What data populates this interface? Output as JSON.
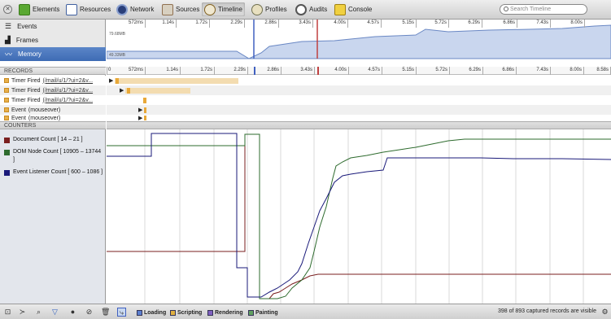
{
  "toolbar": {
    "tabs": [
      {
        "label": "Elements",
        "icon": "elements-icon"
      },
      {
        "label": "Resources",
        "icon": "resources-icon"
      },
      {
        "label": "Network",
        "icon": "network-icon"
      },
      {
        "label": "Sources",
        "icon": "sources-icon"
      },
      {
        "label": "Timeline",
        "icon": "timeline-icon",
        "active": true
      },
      {
        "label": "Profiles",
        "icon": "profiles-icon"
      },
      {
        "label": "Audits",
        "icon": "audits-icon"
      },
      {
        "label": "Console",
        "icon": "console-icon"
      }
    ],
    "search_placeholder": "Search Timeline"
  },
  "overview": {
    "items": [
      {
        "label": "Events",
        "icon": "events-icon"
      },
      {
        "label": "Frames",
        "icon": "frames-icon"
      },
      {
        "label": "Memory",
        "icon": "memory-icon",
        "selected": true
      }
    ],
    "memory_max": "79.68MB",
    "memory_min": "49.33MB"
  },
  "ruler_ticks": [
    "572ms",
    "1.14s",
    "1.72s",
    "2.29s",
    "2.86s",
    "3.43s",
    "4.00s",
    "4.57s",
    "5.15s",
    "5.72s",
    "6.29s",
    "6.86s",
    "7.43s",
    "8.00s",
    "8.58s"
  ],
  "records": {
    "header": "RECORDS",
    "items": [
      {
        "label": "Timer Fired",
        "detail": "(/mail/u/1/?ui=2&v..."
      },
      {
        "label": "Timer Fired",
        "detail": "(/mail/u/1/?ui=2&v..."
      },
      {
        "label": "Timer Fired",
        "detail": "(/mail/u/1/?ui=2&v..."
      },
      {
        "label": "Event",
        "detail": "(mouseover)"
      },
      {
        "label": "Event",
        "detail": "(mouseover)"
      }
    ]
  },
  "counters": {
    "header": "COUNTERS",
    "items": [
      {
        "label": "Document Count [ 14 – 21 ]",
        "color": "#7a1f1f"
      },
      {
        "label": "DOM Node Count [ 10905 – 13744 ]",
        "color": "#2e6b2e"
      },
      {
        "label": "Event Listener Count [ 600 – 1086 ]",
        "color": "#1a1a7a"
      }
    ]
  },
  "filters": [
    {
      "label": "Loading",
      "color": "#5b7fd0"
    },
    {
      "label": "Scripting",
      "color": "#e0b040"
    },
    {
      "label": "Rendering",
      "color": "#8060c0"
    },
    {
      "label": "Painting",
      "color": "#60a060"
    }
  ],
  "status": "398 of 893 captured records are visible"
}
